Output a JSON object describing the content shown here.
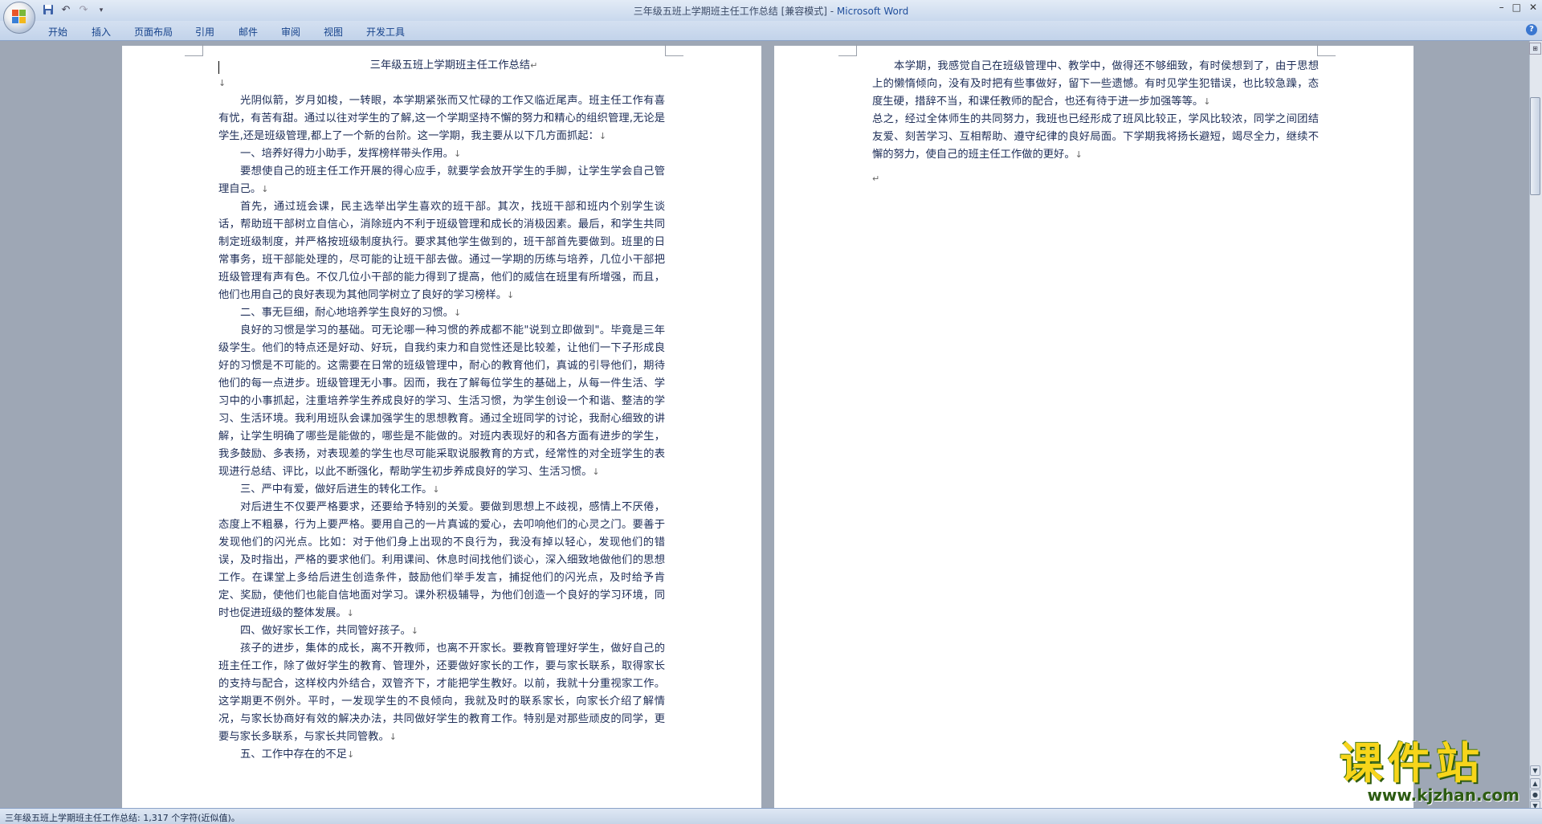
{
  "window": {
    "title": "三年级五班上学期班主任工作总结 [兼容模式] - ",
    "app_name": "Microsoft Word"
  },
  "quick_access": {
    "icons": [
      "save-icon",
      "undo-icon",
      "redo-icon",
      "customize-icon"
    ]
  },
  "ribbon": {
    "tabs": [
      "开始",
      "插入",
      "页面布局",
      "引用",
      "邮件",
      "审阅",
      "视图",
      "开发工具"
    ]
  },
  "document": {
    "page1": {
      "title": "三年级五班上学期班主任工作总结",
      "paragraphs": [
        {
          "style": "plain",
          "text": ""
        },
        {
          "style": "para",
          "text": "光阴似箭，岁月如梭，一转眼，本学期紧张而又忙碌的工作又临近尾声。班主任工作有喜有忧，有苦有甜。通过以往对学生的了解,这一个学期坚持不懈的努力和精心的组织管理,无论是学生,还是班级管理,都上了一个新的台阶。这一学期，我主要从以下几方面抓起："
        },
        {
          "style": "para",
          "text": "一、培养好得力小助手，发挥榜样带头作用。"
        },
        {
          "style": "para",
          "text": "要想使自己的班主任工作开展的得心应手，就要学会放开学生的手脚，让学生学会自己管理自己。"
        },
        {
          "style": "para",
          "text": "首先，通过班会课，民主选举出学生喜欢的班干部。其次，找班干部和班内个别学生谈话，帮助班干部树立自信心，消除班内不利于班级管理和成长的消极因素。最后，和学生共同制定班级制度，并严格按班级制度执行。要求其他学生做到的，班干部首先要做到。班里的日常事务，班干部能处理的，尽可能的让班干部去做。通过一学期的历练与培养，几位小干部把班级管理有声有色。不仅几位小干部的能力得到了提高，他们的威信在班里有所增强，而且，他们也用自己的良好表现为其他同学树立了良好的学习榜样。"
        },
        {
          "style": "para",
          "text": "二、事无巨细，耐心地培养学生良好的习惯。"
        },
        {
          "style": "para",
          "text": "良好的习惯是学习的基础。可无论哪一种习惯的养成都不能\"说到立即做到\"。毕竟是三年级学生。他们的特点还是好动、好玩，自我约束力和自觉性还是比较差，让他们一下子形成良好的习惯是不可能的。这需要在日常的班级管理中，耐心的教育他们，真诚的引导他们，期待他们的每一点进步。班级管理无小事。因而，我在了解每位学生的基础上，从每一件生活、学习中的小事抓起，注重培养学生养成良好的学习、生活习惯，为学生创设一个和谐、整洁的学习、生活环境。我利用班队会课加强学生的思想教育。通过全班同学的讨论，我耐心细致的讲解，让学生明确了哪些是能做的，哪些是不能做的。对班内表现好的和各方面有进步的学生，我多鼓励、多表扬，对表现差的学生也尽可能采取说服教育的方式，经常性的对全班学生的表现进行总结、评比，以此不断强化，帮助学生初步养成良好的学习、生活习惯。"
        },
        {
          "style": "para",
          "text": "三、严中有爱，做好后进生的转化工作。"
        },
        {
          "style": "para",
          "text": "对后进生不仅要严格要求，还要给予特别的关爱。要做到思想上不歧视，感情上不厌倦，态度上不粗暴，行为上要严格。要用自己的一片真诚的爱心，去叩响他们的心灵之门。要善于发现他们的闪光点。比如：对于他们身上出现的不良行为，我没有掉以轻心，发现他们的错误，及时指出，严格的要求他们。利用课间、休息时间找他们谈心，深入细致地做他们的思想工作。在课堂上多给后进生创造条件，鼓励他们举手发言，捕捉他们的闪光点，及时给予肯定、奖励，使他们也能自信地面对学习。课外积极辅导，为他们创造一个良好的学习环境，同时也促进班级的整体发展。"
        },
        {
          "style": "para",
          "text": "四、做好家长工作，共同管好孩子。"
        },
        {
          "style": "para",
          "text": "孩子的进步，集体的成长，离不开教师，也离不开家长。要教育管理好学生，做好自己的班主任工作，除了做好学生的教育、管理外，还要做好家长的工作，要与家长联系，取得家长的支持与配合，这样校内外结合，双管齐下，才能把学生教好。以前，我就十分重视家工作。这学期更不例外。平时，一发现学生的不良倾向，我就及时的联系家长，向家长介绍了解情况，与家长协商好有效的解决办法，共同做好学生的教育工作。特别是对那些顽皮的同学，更要与家长多联系，与家长共同管教。"
        },
        {
          "style": "para",
          "text": "五、工作中存在的不足"
        }
      ]
    },
    "page2": {
      "paragraphs": [
        {
          "style": "para",
          "text": "本学期，我感觉自己在班级管理中、教学中，做得还不够细致，有时侯想到了，由于思想上的懒惰倾向，没有及时把有些事做好，留下一些遗憾。有时见学生犯错误，也比较急躁，态度生硬，措辞不当，和课任教师的配合，也还有待于进一步加强等等。"
        },
        {
          "style": "plain",
          "text": "总之，经过全体师生的共同努力，我班也已经形成了班风比较正，学风比较浓，同学之间团结友爱、刻苦学习、互相帮助、遵守纪律的良好局面。下学期我将扬长避短，竭尽全力，继续不懈的努力，使自己的班主任工作做的更好。"
        },
        {
          "style": "plain",
          "text": ""
        }
      ]
    }
  },
  "marks": {
    "paragraph": "↵",
    "line_break": "↓"
  },
  "status_bar": {
    "text": "三年级五班上学期班主任工作总结: 1,317 个字符(近似值)。"
  },
  "watermark": {
    "text": "课件站",
    "url": "www.kjzhan.com"
  },
  "colors": {
    "title_bar": "#d2deef",
    "ribbon_tab_text": "#15428b",
    "doc_text": "#1d2d57",
    "background": "#9ea7b5",
    "watermark_yellow": "#f7d51a"
  }
}
